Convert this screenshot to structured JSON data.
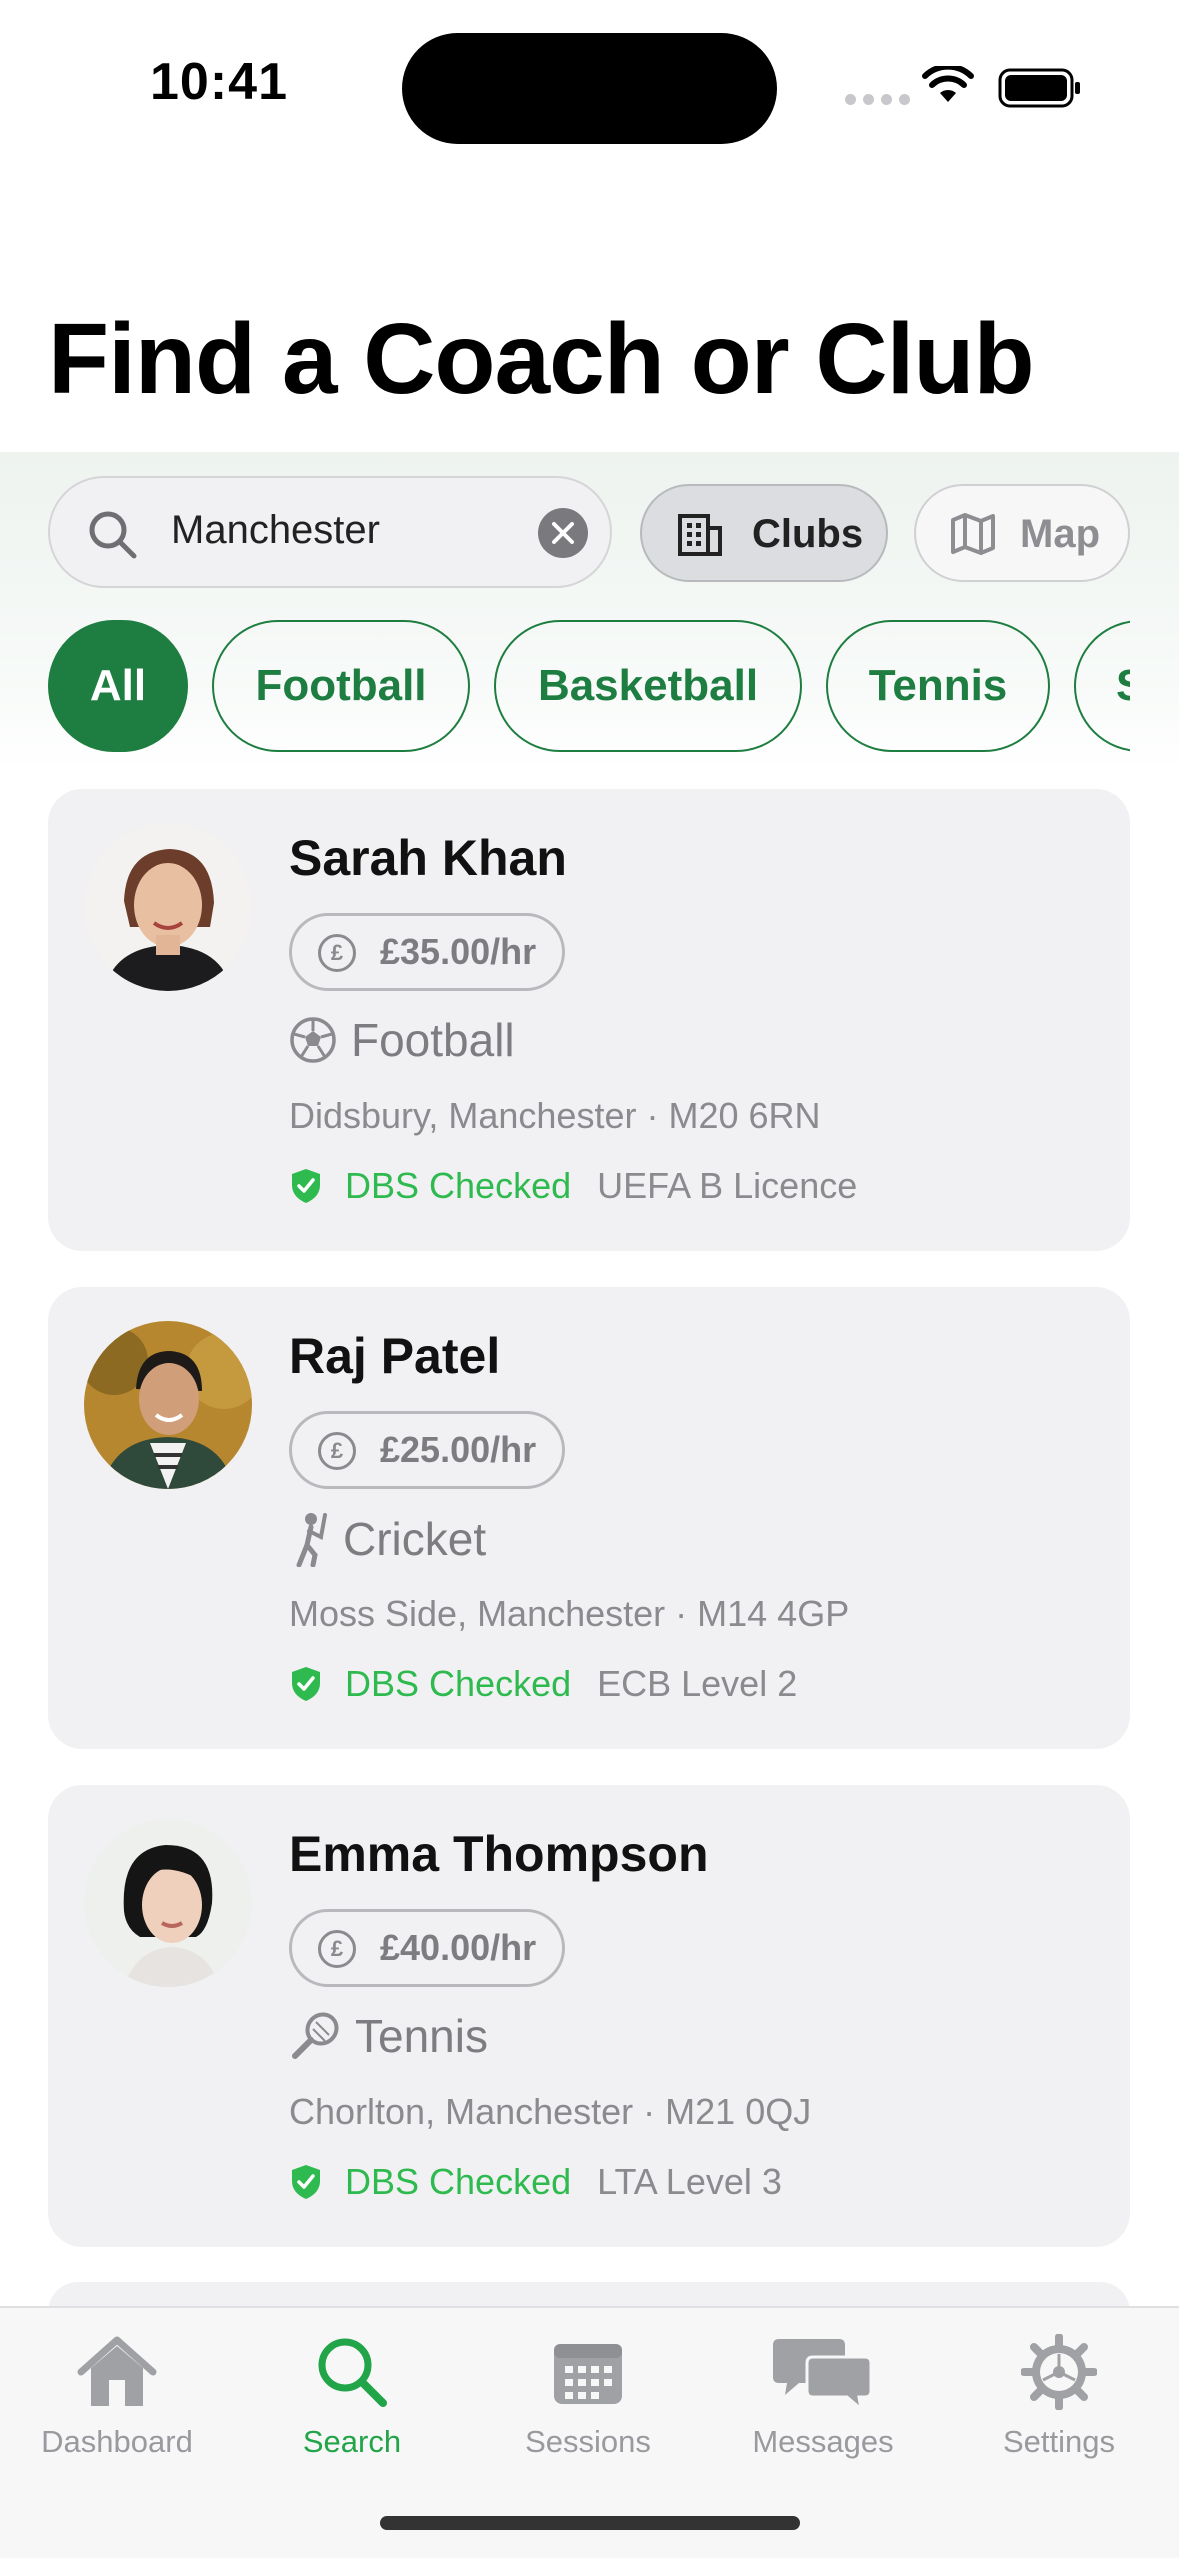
{
  "status_bar": {
    "time": "10:41"
  },
  "header": {
    "title": "Find a Coach or Club"
  },
  "search": {
    "value": "Manchester"
  },
  "toggles": {
    "clubs_label": "Clubs",
    "map_label": "Map"
  },
  "sport_filters": [
    "All",
    "Football",
    "Basketball",
    "Tennis",
    "S"
  ],
  "results": [
    {
      "name": "Sarah Khan",
      "price": "£35.00/hr",
      "sport": "Football",
      "sport_icon": "football-icon",
      "location": "Didsbury, Manchester · M20 6RN",
      "dbs": "DBS Checked",
      "licence": "UEFA B Licence"
    },
    {
      "name": "Raj Patel",
      "price": "£25.00/hr",
      "sport": "Cricket",
      "sport_icon": "cricket-icon",
      "location": "Moss Side, Manchester · M14 4GP",
      "dbs": "DBS Checked",
      "licence": "ECB Level 2"
    },
    {
      "name": "Emma Thompson",
      "price": "£40.00/hr",
      "sport": "Tennis",
      "sport_icon": "tennis-racket-icon",
      "location": "Chorlton, Manchester · M21 0QJ",
      "dbs": "DBS Checked",
      "licence": "LTA Level 3"
    }
  ],
  "tab_bar": {
    "items": [
      {
        "label": "Dashboard",
        "icon": "house-icon"
      },
      {
        "label": "Search",
        "icon": "search-icon"
      },
      {
        "label": "Sessions",
        "icon": "calendar-icon"
      },
      {
        "label": "Messages",
        "icon": "chat-bubbles-icon"
      },
      {
        "label": "Settings",
        "icon": "gear-icon"
      }
    ],
    "active": "Search"
  },
  "colors": {
    "brand_green": "#1e7d40",
    "dbs_green": "#2fba4f",
    "tab_active": "#21a548"
  }
}
